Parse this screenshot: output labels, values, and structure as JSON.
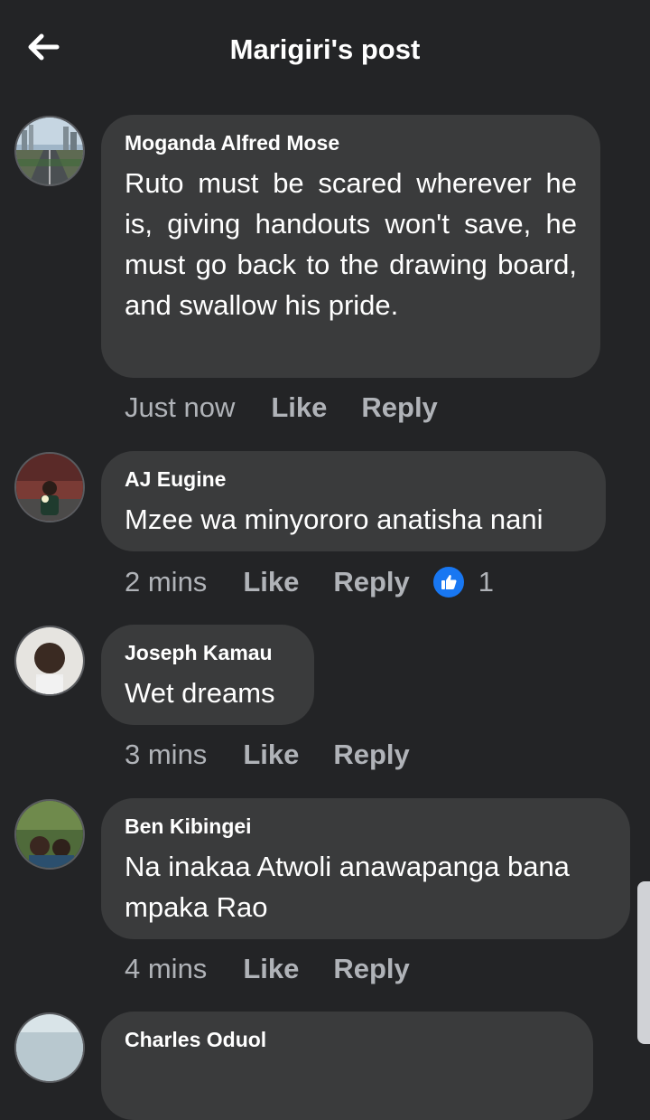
{
  "header": {
    "back_icon": "arrow-left-icon",
    "title": "Marigiri's post"
  },
  "comments": [
    {
      "author": "Moganda Alfred Mose",
      "text": "Ruto must be scared wherever he is, giving handouts won't save, he must go back to the drawing board, and swallow his pride.",
      "time": "Just now",
      "like_label": "Like",
      "reply_label": "Reply"
    },
    {
      "author": "AJ Eugine",
      "text": "Mzee wa minyororo anatisha nani",
      "time": "2 mins",
      "like_label": "Like",
      "reply_label": "Reply",
      "reaction_icon": "thumbs-up-icon",
      "reaction_count": "1"
    },
    {
      "author": "Joseph Kamau",
      "text": "Wet dreams",
      "time": "3 mins",
      "like_label": "Like",
      "reply_label": "Reply"
    },
    {
      "author": "Ben Kibingei",
      "text": "Na inakaa Atwoli anawapanga bana mpaka Rao",
      "time": "4 mins",
      "like_label": "Like",
      "reply_label": "Reply"
    },
    {
      "author": "Charles Oduol"
    }
  ],
  "colors": {
    "background": "#232426",
    "bubble": "#3a3b3c",
    "muted_text": "#b0b3b8",
    "like_blue": "#1877f2"
  }
}
